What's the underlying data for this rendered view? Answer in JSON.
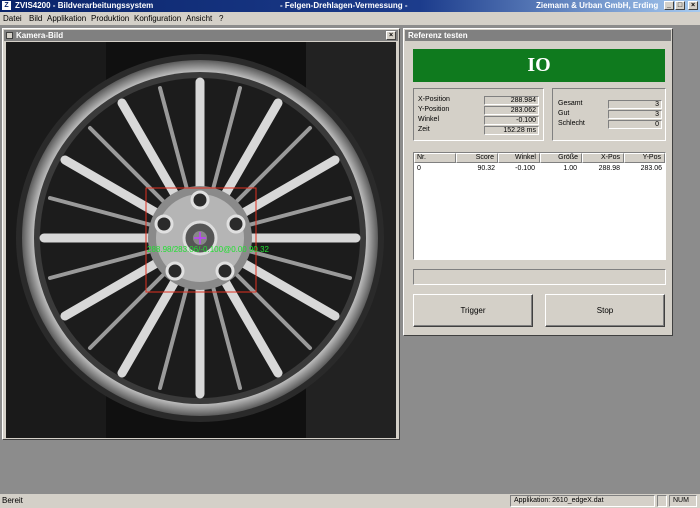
{
  "titlebar": {
    "app_name": "ZVIS4200 - Bildverarbeitungssystem",
    "document": "- Felgen-Drehlagen-Vermessung -",
    "company": "Ziemann & Urban GmbH, Erding"
  },
  "menu": [
    "Datei",
    "Bild",
    "Applikation",
    "Produktion",
    "Konfiguration",
    "Ansicht",
    "?"
  ],
  "camera_window": {
    "title": "Kamera-Bild",
    "overlay_text": "288.98/283.06/-0.100@0.00 90.32"
  },
  "reference_window": {
    "title": "Referenz testen",
    "result": "IO",
    "result_color": "#0f7a1e",
    "measurements": [
      {
        "label": "X-Position",
        "value": "288.984"
      },
      {
        "label": "Y-Position",
        "value": "283.062"
      },
      {
        "label": "Winkel",
        "value": "-0.100"
      },
      {
        "label": "Zeit",
        "value": "152.28 ms"
      }
    ],
    "counters": [
      {
        "label": "Gesamt",
        "value": "3"
      },
      {
        "label": "Gut",
        "value": "3"
      },
      {
        "label": "Schlecht",
        "value": "0"
      }
    ],
    "table": {
      "columns": [
        "Nr.",
        "Score",
        "Winkel",
        "Größe",
        "X-Pos",
        "Y-Pos"
      ],
      "rows": [
        [
          "0",
          "90.32",
          "-0.100",
          "1.00",
          "288.98",
          "283.06"
        ]
      ]
    },
    "trigger_button": "Trigger",
    "stop_button": "Stop"
  },
  "statusbar": {
    "status": "Bereit",
    "application": "Applikation: 2610_edgeX.dat",
    "num": "NUM"
  }
}
